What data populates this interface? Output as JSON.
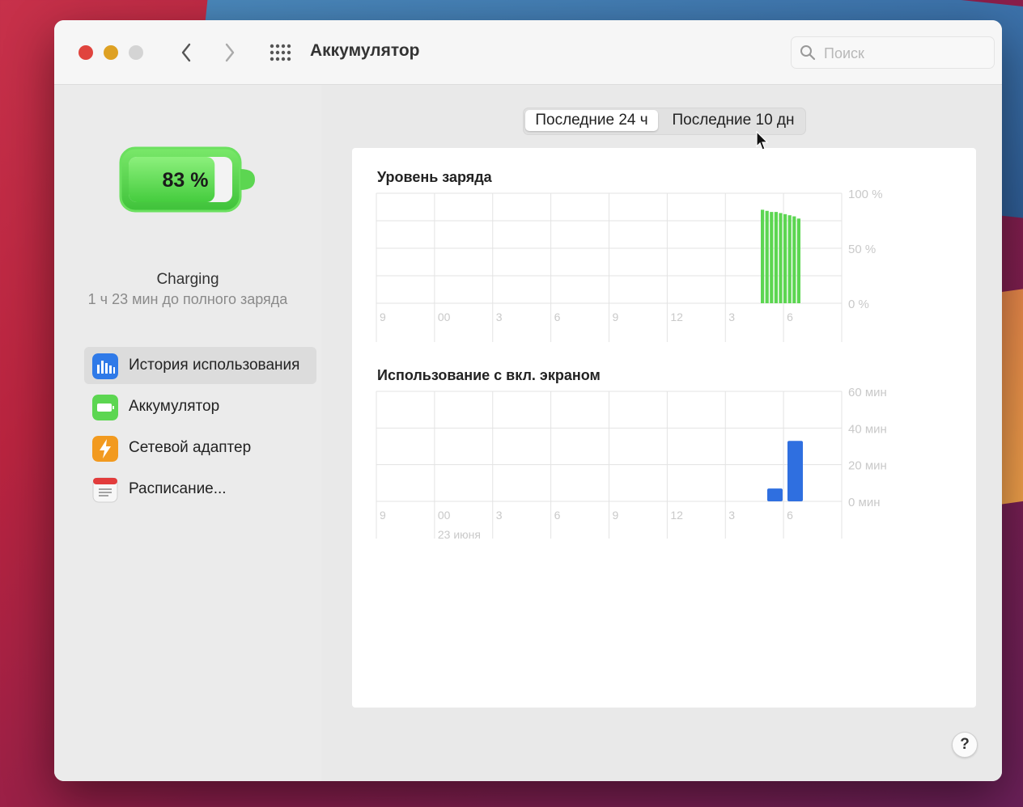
{
  "window": {
    "title": "Аккумулятор",
    "search_placeholder": "Поиск"
  },
  "battery": {
    "percent_label": "83 %",
    "level": 0.83,
    "status": "Charging",
    "time_remaining": "1 ч 23 мин до полного заряда"
  },
  "sidebar": {
    "items": [
      {
        "label": "История использования",
        "icon": "usage-history-icon",
        "active": true
      },
      {
        "label": "Аккумулятор",
        "icon": "battery-icon",
        "active": false
      },
      {
        "label": "Сетевой адаптер",
        "icon": "power-adapter-icon",
        "active": false
      },
      {
        "label": "Расписание...",
        "icon": "schedule-icon",
        "active": false
      }
    ]
  },
  "segmented": {
    "options": [
      "Последние 24 ч",
      "Последние 10 дн"
    ],
    "selected": 0
  },
  "colors": {
    "battery_green": "#5cd651",
    "screen_blue": "#2f6fe0",
    "close_red": "#e0443e",
    "minimize_yellow": "#dea123"
  },
  "chart_data": [
    {
      "type": "bar",
      "title": "Уровень заряда",
      "x_ticks": [
        "9",
        "00",
        "3",
        "6",
        "9",
        "12",
        "3",
        "6"
      ],
      "y_ticks": [
        "100 %",
        "50 %",
        "0 %"
      ],
      "ylim": [
        0,
        100
      ],
      "series": [
        {
          "values": [
            85,
            84,
            83,
            83,
            82,
            81,
            80,
            79,
            77
          ]
        }
      ]
    },
    {
      "type": "bar",
      "title": "Использование с вкл. экраном",
      "x_ticks": [
        "9",
        "00",
        "3",
        "6",
        "9",
        "12",
        "3",
        "6"
      ],
      "x_sublabel": "23 июня",
      "y_ticks": [
        "60 мин",
        "40 мин",
        "20 мин",
        "0 мин"
      ],
      "ylim": [
        0,
        60
      ],
      "series": [
        {
          "values": [
            7,
            33
          ]
        }
      ]
    }
  ],
  "help_label": "?"
}
